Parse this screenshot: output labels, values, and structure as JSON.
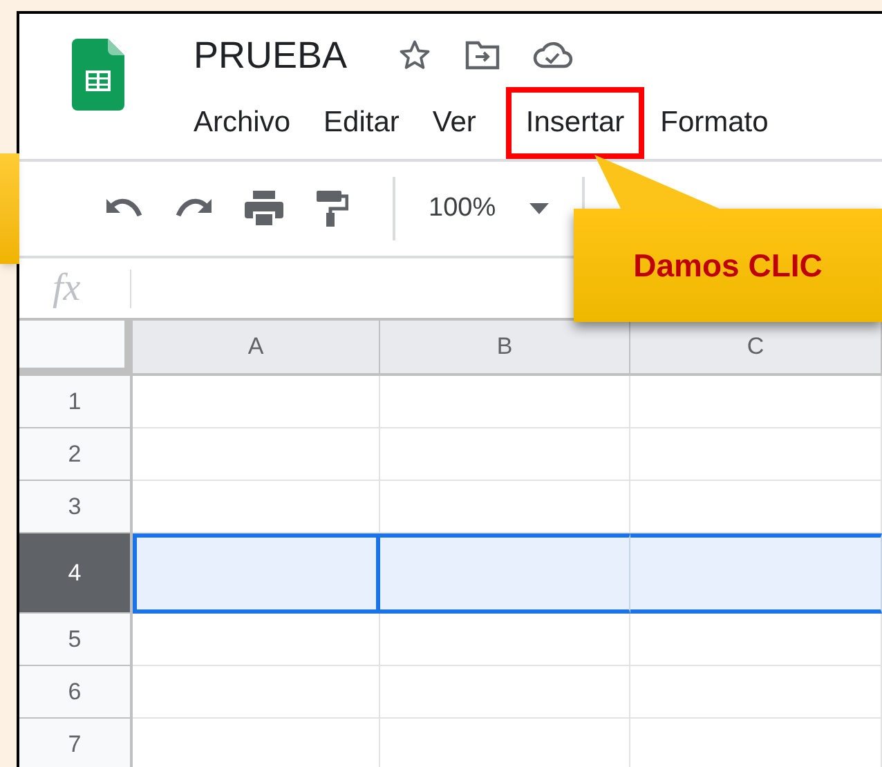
{
  "document": {
    "title": "PRUEBA"
  },
  "menu": [
    {
      "label": "Archivo",
      "highlighted": false
    },
    {
      "label": "Editar",
      "highlighted": false
    },
    {
      "label": "Ver",
      "highlighted": false
    },
    {
      "label": "Insertar",
      "highlighted": true
    },
    {
      "label": "Formato",
      "highlighted": false
    }
  ],
  "toolbar": {
    "zoom": "100%"
  },
  "formula_bar": {
    "label": "fx"
  },
  "columns": [
    "A",
    "B",
    "C"
  ],
  "rows": [
    {
      "label": "1",
      "selected": false
    },
    {
      "label": "2",
      "selected": false
    },
    {
      "label": "3",
      "selected": false
    },
    {
      "label": "4",
      "selected": true
    },
    {
      "label": "5",
      "selected": false
    },
    {
      "label": "6",
      "selected": false
    },
    {
      "label": "7",
      "selected": false
    }
  ],
  "callout": {
    "text": "Damos CLIC"
  }
}
